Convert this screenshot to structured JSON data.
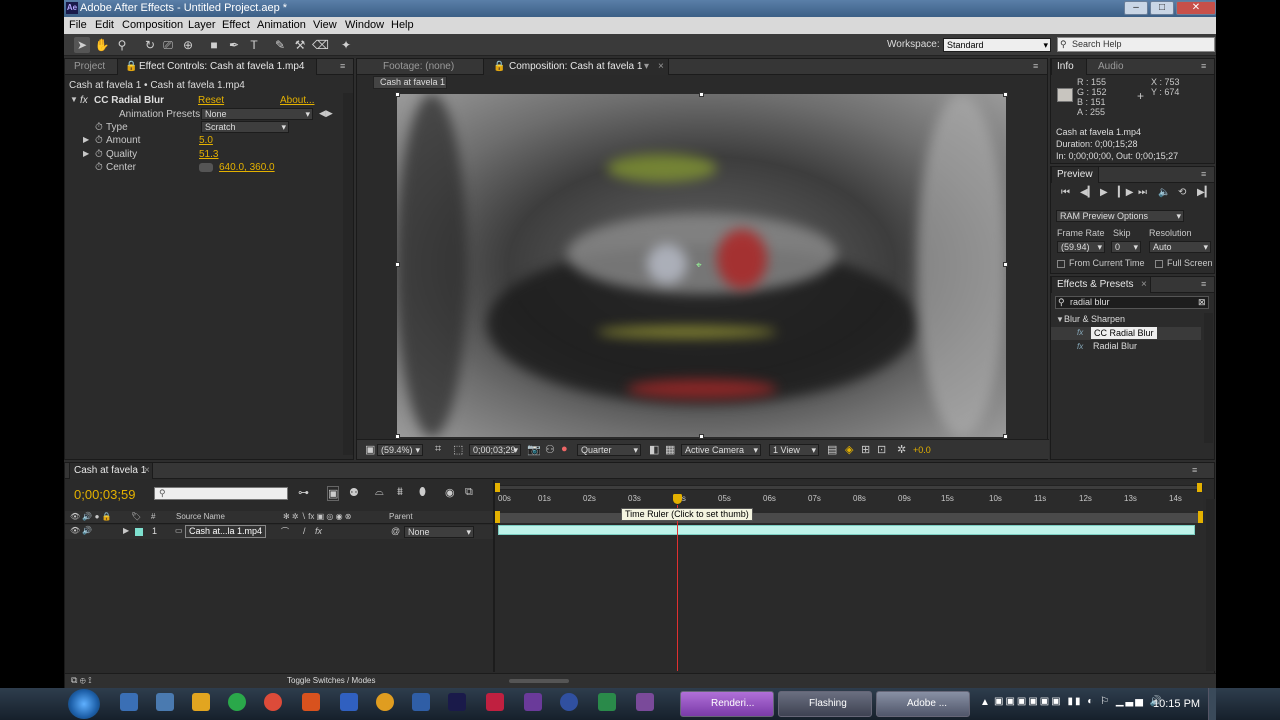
{
  "title": "Adobe After Effects - Untitled Project.aep *",
  "menu": [
    "File",
    "Edit",
    "Composition",
    "Layer",
    "Effect",
    "Animation",
    "View",
    "Window",
    "Help"
  ],
  "workspace": {
    "label": "Workspace:",
    "value": "Standard"
  },
  "search_help": "Search Help",
  "left_panel": {
    "tabs": [
      "Project",
      "Effect Controls: Cash at favela 1.mp4"
    ],
    "breadcrumb": "Cash at favela 1 • Cash at favela 1.mp4",
    "effect_name": "CC Radial Blur",
    "reset": "Reset",
    "about": "About...",
    "animation_presets_label": "Animation Presets:",
    "animation_presets_value": "None",
    "props": [
      {
        "name": "Type",
        "value": "Scratch"
      },
      {
        "name": "Amount",
        "value": "5.0"
      },
      {
        "name": "Quality",
        "value": "51.3"
      },
      {
        "name": "Center",
        "value": "640.0, 360.0"
      }
    ]
  },
  "comp_panel": {
    "tabs": [
      "Footage: (none)",
      "Composition: Cash at favela 1"
    ],
    "subtab": "Cash at favela 1",
    "zoom": "(59.4%)",
    "timecode": "0;00;03;29",
    "resolution": "Quarter",
    "camera": "Active Camera",
    "views": "1 View",
    "exposure": "+0.0"
  },
  "info_panel": {
    "tabs": [
      "Info",
      "Audio"
    ],
    "r": "R : 155",
    "g": "G : 152",
    "b": "B : 151",
    "a": "A : 255",
    "x": "X : 753",
    "y": "Y : 674",
    "file": "Cash at favela 1.mp4",
    "duration": "Duration: 0;00;15;28",
    "inout": "In: 0;00;00;00, Out: 0;00;15;27",
    "swatch_color": "#c8c5bf"
  },
  "preview_panel": {
    "title": "Preview",
    "ram_options": "RAM Preview Options",
    "frame_rate_label": "Frame Rate",
    "skip_label": "Skip",
    "resolution_label": "Resolution",
    "frame_rate_value": "(59.94)",
    "skip_value": "0",
    "resolution_value": "Auto",
    "from_current": "From Current Time",
    "full_screen": "Full Screen"
  },
  "effects_panel": {
    "title": "Effects & Presets",
    "search": "radial blur",
    "category": "Blur & Sharpen",
    "items": [
      "CC Radial Blur",
      "Radial Blur"
    ]
  },
  "timeline": {
    "tab": "Cash at favela 1",
    "timecode": "0;00;03;59",
    "ruler_ticks": [
      "00s",
      "01s",
      "02s",
      "03s",
      "04s",
      "05s",
      "06s",
      "07s",
      "08s",
      "09s",
      "10s",
      "11s",
      "12s",
      "13s",
      "14s",
      "15s"
    ],
    "tooltip": "Time Ruler (Click to set thumb)",
    "headers": {
      "source_name": "Source Name",
      "parent": "Parent",
      "hash": "#"
    },
    "layers": [
      {
        "index": "1",
        "name": "Cash at...la 1.mp4",
        "parent": "None"
      }
    ],
    "toggle": "Toggle Switches / Modes"
  },
  "taskbar": {
    "buttons": [
      "Renderi...",
      "Flashing",
      "Adobe ..."
    ],
    "clock": "10:15 PM"
  },
  "colors": {
    "accent": "#e4b100",
    "playhead": "#e03030",
    "layer_bar": "#bff3ea"
  }
}
